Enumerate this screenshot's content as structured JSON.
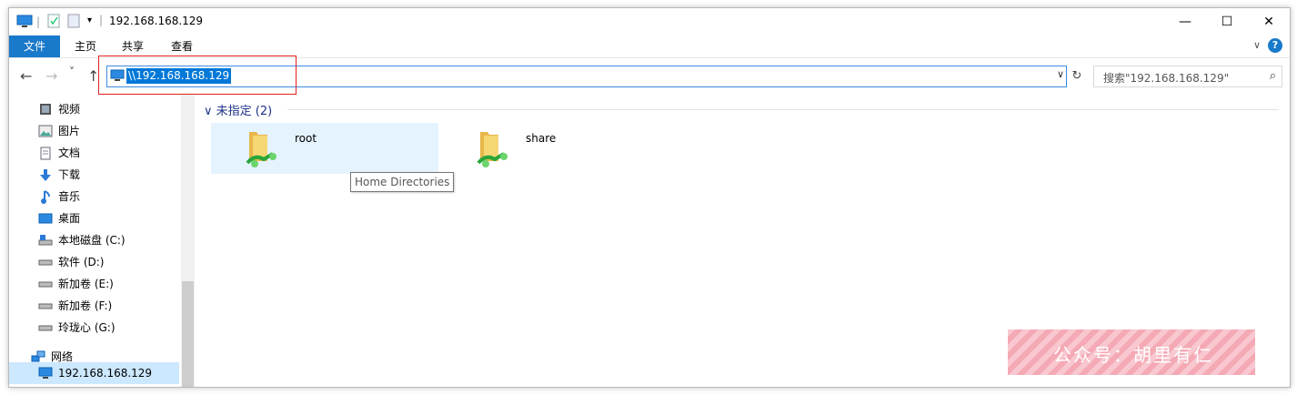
{
  "window": {
    "title": "192.168.168.129",
    "controls": {
      "minimize": "—",
      "maximize": "☐",
      "close": "✕"
    }
  },
  "ribbon": {
    "tabs": [
      "文件",
      "主页",
      "共享",
      "查看"
    ],
    "help": "?",
    "expand": "∨"
  },
  "nav": {
    "back": "←",
    "forward": "→",
    "recent": "˅",
    "up": "↑",
    "address": "\\\\192.168.168.129",
    "address_dropdown": "∨",
    "refresh": "↻",
    "search_placeholder": "搜索\"192.168.168.129\"",
    "search_icon": "⌕"
  },
  "sidebar": {
    "items": [
      {
        "label": "视频",
        "icon": "video-icon"
      },
      {
        "label": "图片",
        "icon": "pictures-icon"
      },
      {
        "label": "文档",
        "icon": "documents-icon"
      },
      {
        "label": "下载",
        "icon": "downloads-icon"
      },
      {
        "label": "音乐",
        "icon": "music-icon"
      },
      {
        "label": "桌面",
        "icon": "desktop-icon"
      },
      {
        "label": "本地磁盘 (C:)",
        "icon": "drive-c-icon"
      },
      {
        "label": "软件 (D:)",
        "icon": "drive-icon"
      },
      {
        "label": "新加卷 (E:)",
        "icon": "drive-icon"
      },
      {
        "label": "新加卷 (F:)",
        "icon": "drive-icon"
      },
      {
        "label": "玲珑心 (G:)",
        "icon": "drive-icon"
      }
    ],
    "network": {
      "label": "网络",
      "icon": "network-icon"
    },
    "selected": {
      "label": "192.168.168.129",
      "icon": "computer-icon"
    }
  },
  "main": {
    "group_label": "未指定 (2)",
    "group_chevron": "∨",
    "folders": [
      {
        "name": "root",
        "selected": true,
        "icon": "shared-folder-icon"
      },
      {
        "name": "share",
        "selected": false,
        "icon": "shared-folder-icon"
      }
    ],
    "tooltip": "Home Directories"
  },
  "watermark": {
    "text": "公众号：胡里有仁"
  },
  "colors": {
    "accent": "#1979ca",
    "selection": "#0078d7",
    "hover": "#e5f3ff",
    "redbox": "#e02020"
  }
}
